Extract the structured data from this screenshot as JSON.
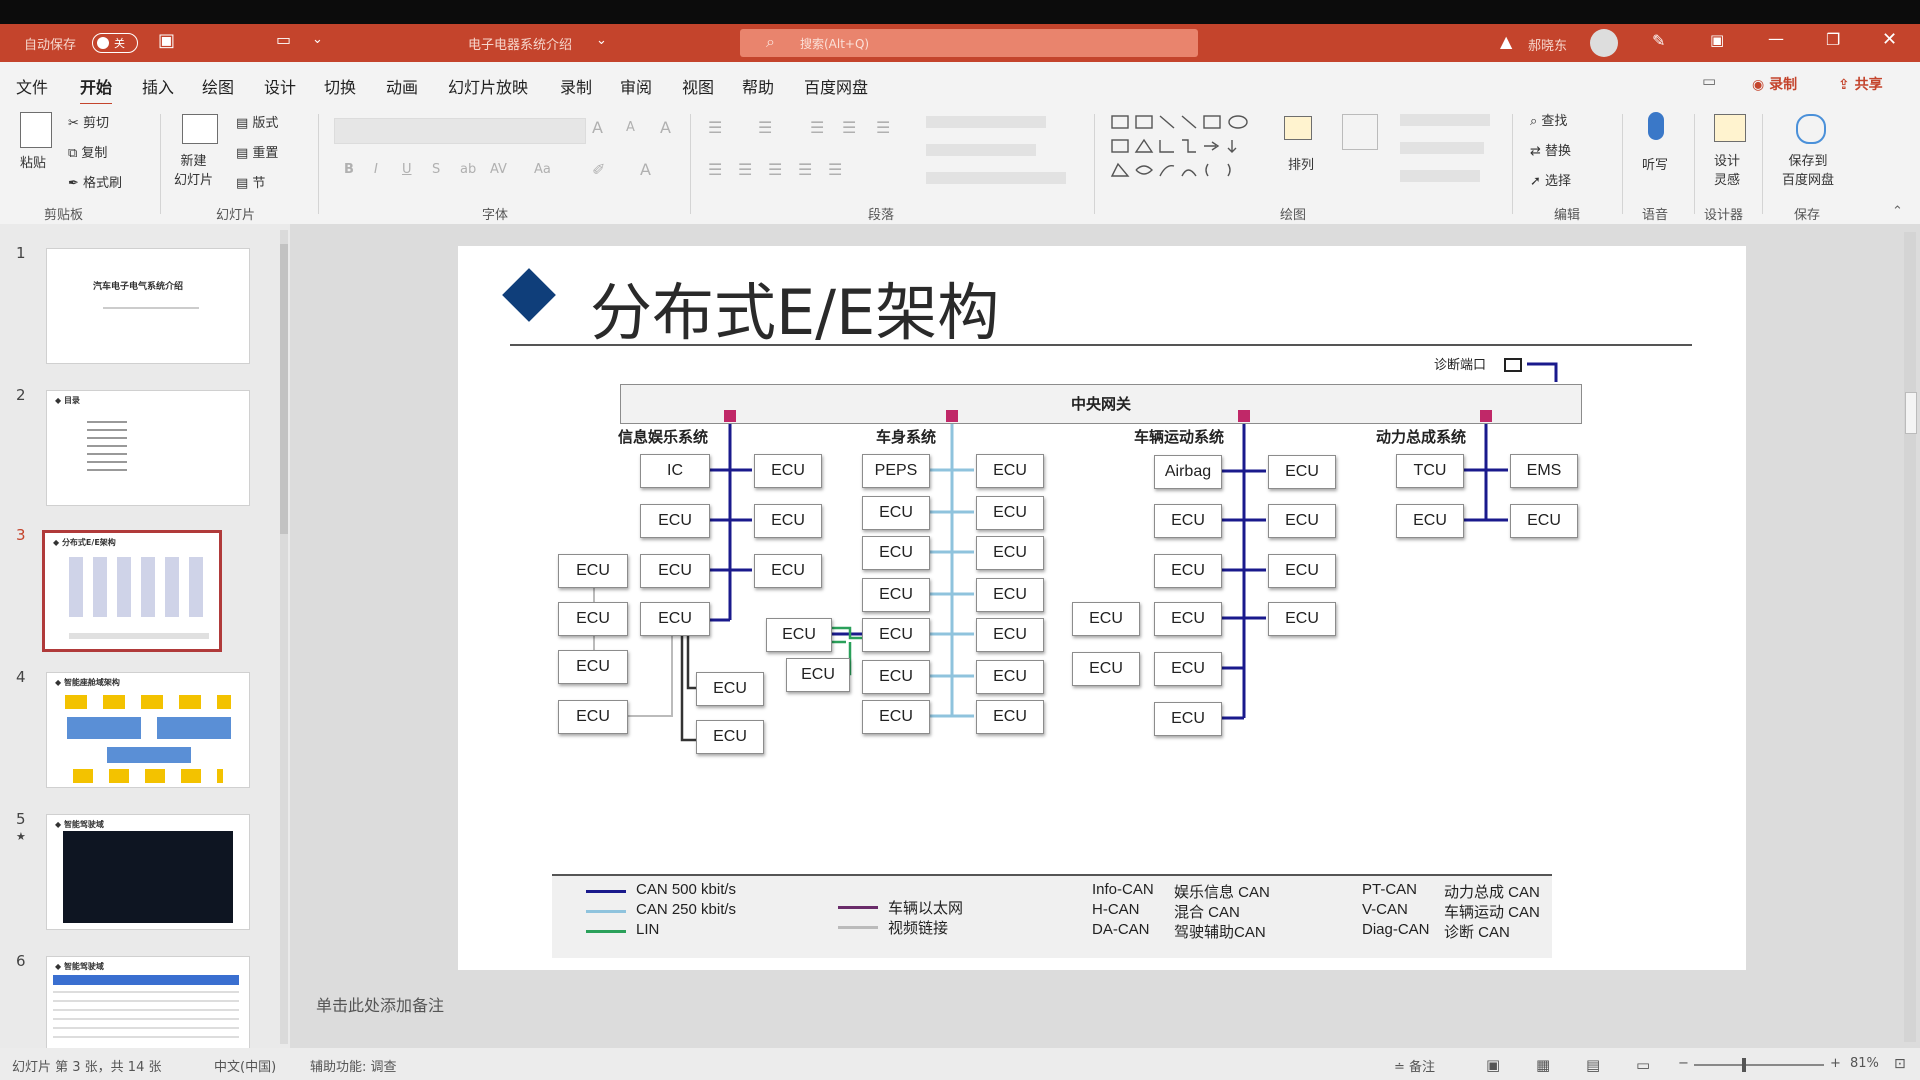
{
  "titlebar": {
    "autosave_label": "自动保存",
    "autosave_state": "关",
    "doc_title": "电子电器系统介绍",
    "search_placeholder": "搜索(Alt+Q)",
    "user_name": "郝晓东"
  },
  "menu": [
    "文件",
    "开始",
    "插入",
    "绘图",
    "设计",
    "切换",
    "动画",
    "幻灯片放映",
    "录制",
    "审阅",
    "视图",
    "帮助",
    "百度网盘"
  ],
  "menu_right": {
    "record_label": "录制",
    "share_label": "共享"
  },
  "ribbon": {
    "paste_label": "粘贴",
    "cut_label": "剪切",
    "copy_label": "复制",
    "format_painter_label": "格式刷",
    "clipboard_group": "剪贴板",
    "new_slide_label": "新建\n幻灯片",
    "layout_label": "版式",
    "reset_label": "重置",
    "section_label": "节",
    "slides_group": "幻灯片",
    "font_group": "字体",
    "paragraph_group": "段落",
    "arrange_label": "排列",
    "drawing_group": "绘图",
    "find_label": "查找",
    "replace_label": "替换",
    "select_label": "选择",
    "editing_group": "编辑",
    "dictate_label": "听写",
    "voice_group": "语音",
    "designer_label": "设计\n灵感",
    "designer_group": "设计器",
    "save_baidu_label": "保存到\n百度网盘",
    "save_group": "保存"
  },
  "thumbs": [
    {
      "num": "1",
      "title": "汽车电子电气系统介绍"
    },
    {
      "num": "2",
      "title": "目录"
    },
    {
      "num": "3",
      "title": "分布式E/E架构"
    },
    {
      "num": "4",
      "title": "智能座舱域架构"
    },
    {
      "num": "5",
      "title": "智能驾驶域"
    },
    {
      "num": "6",
      "title": "智能驾驶域"
    }
  ],
  "slide": {
    "title": "分布式E/E架构",
    "diag_port": "诊断端口",
    "gateway": "中央网关",
    "domains": {
      "info": "信息娱乐系统",
      "body": "车身系统",
      "chassis": "车辆运动系统",
      "power": "动力总成系统"
    },
    "ecu_label": "ECU",
    "ic_label": "IC",
    "peps_label": "PEPS",
    "airbag_label": "Airbag",
    "tcu_label": "TCU",
    "ems_label": "EMS",
    "legend": {
      "can500": "CAN 500 kbit/s",
      "can250": "CAN 250 kbit/s",
      "lin": "LIN",
      "ethernet": "车辆以太网",
      "video": "视频链接",
      "info_can": "Info-CAN",
      "info_can_desc": "娱乐信息 CAN",
      "h_can": "H-CAN",
      "h_can_desc": "混合 CAN",
      "da_can": "DA-CAN",
      "da_can_desc": "驾驶辅助CAN",
      "pt_can": "PT-CAN",
      "pt_can_desc": "动力总成 CAN",
      "v_can": "V-CAN",
      "v_can_desc": "车辆运动 CAN",
      "diag_can": "Diag-CAN",
      "diag_can_desc": "诊断 CAN"
    }
  },
  "notes_placeholder": "单击此处添加备注",
  "statusbar": {
    "slide_info": "幻灯片 第 3 张，共 14 张",
    "language": "中文(中国)",
    "accessibility": "辅助功能: 调查",
    "notes_label": "备注",
    "zoom": "81%"
  },
  "colors": {
    "accent": "#c4442c",
    "can500": "#1a1a8c",
    "can250": "#8fc3dd",
    "lin": "#2aa05a",
    "ethernet": "#6a2c6a",
    "video": "#bbbbbb",
    "title_diamond": "#0f3e7a"
  }
}
